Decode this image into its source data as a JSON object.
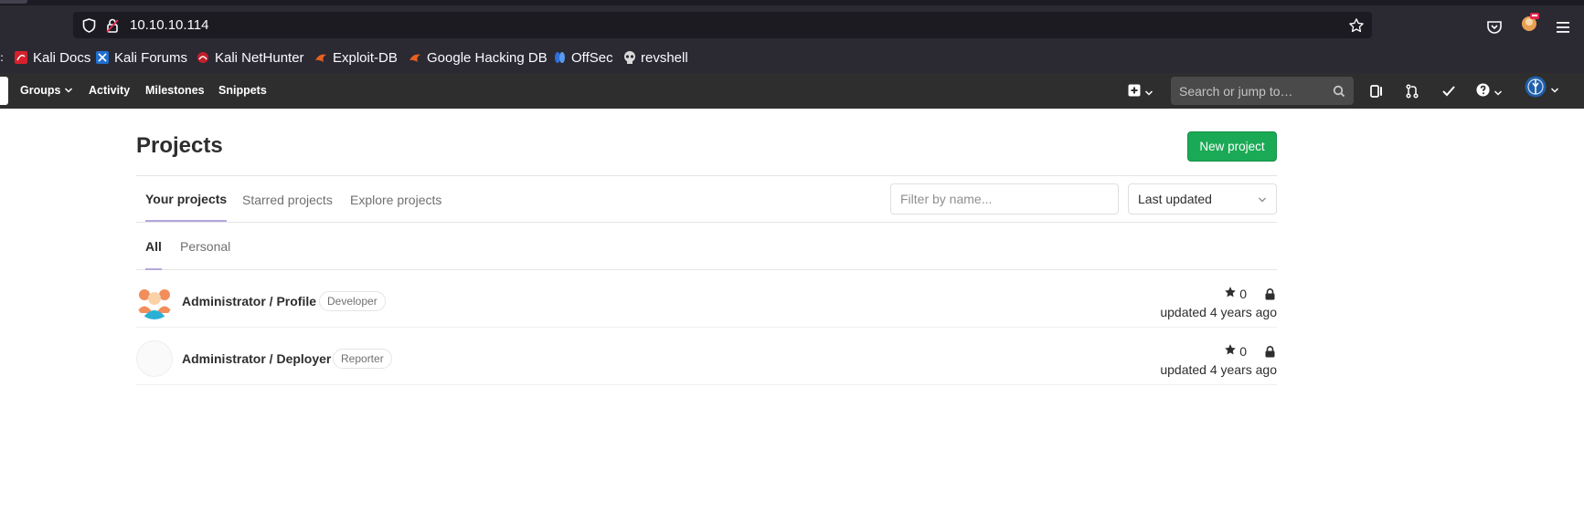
{
  "browser": {
    "url": "10.10.10.114",
    "bookmarks": [
      {
        "label": "Kali Docs",
        "icon": "kali-docs-icon"
      },
      {
        "label": "Kali Forums",
        "icon": "kali-forums-icon"
      },
      {
        "label": "Kali NetHunter",
        "icon": "kali-nethunter-icon"
      },
      {
        "label": "Exploit-DB",
        "icon": "exploit-db-icon"
      },
      {
        "label": "Google Hacking DB",
        "icon": "ghdb-icon"
      },
      {
        "label": "OffSec",
        "icon": "offsec-icon"
      },
      {
        "label": "revshell",
        "icon": "skull-icon"
      }
    ]
  },
  "gitlab_header": {
    "nav": [
      {
        "label": "Groups"
      },
      {
        "label": "Activity"
      },
      {
        "label": "Milestones"
      },
      {
        "label": "Snippets"
      }
    ],
    "search_placeholder": "Search or jump to…",
    "brand_color": "#2e2e2e"
  },
  "page": {
    "title": "Projects",
    "new_project_label": "New project",
    "accent_color": "#1aaa55",
    "tabs": [
      {
        "label": "Your projects",
        "active": true
      },
      {
        "label": "Starred projects",
        "active": false
      },
      {
        "label": "Explore projects",
        "active": false
      }
    ],
    "filter_placeholder": "Filter by name...",
    "sort_selected": "Last updated",
    "subtabs": [
      {
        "label": "All",
        "active": true
      },
      {
        "label": "Personal",
        "active": false
      }
    ],
    "projects": [
      {
        "name": "Administrator / Profile",
        "role": "Developer",
        "stars": "0",
        "updated": "updated 4 years ago",
        "avatar": "group-avatar"
      },
      {
        "name": "Administrator / Deployer",
        "role": "Reporter",
        "stars": "0",
        "updated": "updated 4 years ago",
        "avatar": "blank-avatar"
      }
    ]
  }
}
